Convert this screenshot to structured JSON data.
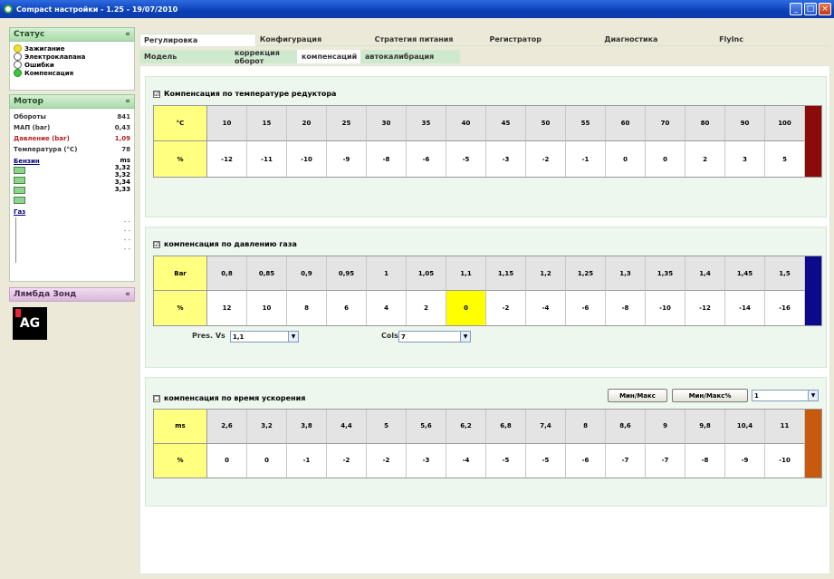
{
  "window": {
    "title": "Compact настройки - 1.25 - 19/07/2010"
  },
  "status": {
    "title": "Статус",
    "collapse": "«",
    "items": [
      {
        "label": "Зажигание",
        "state": "yellow"
      },
      {
        "label": "Электроклапана",
        "state": "off"
      },
      {
        "label": "Ошибки",
        "state": "off"
      },
      {
        "label": "Компенсация",
        "state": "green"
      }
    ]
  },
  "motor": {
    "title": "Мотор",
    "collapse": "«",
    "rows": [
      {
        "label": "Обороты",
        "value": "841"
      },
      {
        "label": "МАП (bar)",
        "value": "0,43"
      },
      {
        "label": "Давление (bar)",
        "value": "1,09"
      },
      {
        "label": "Температура (°C)",
        "value": "78"
      }
    ],
    "benzin_label": "Бензин",
    "benzin_unit": "ms",
    "benzin_values": [
      "3,32",
      "3,32",
      "3,34",
      "3,33"
    ],
    "gas_label": "Газ",
    "gas_values": [
      "- -",
      "- -",
      "- -",
      "- -"
    ]
  },
  "lambda": {
    "title": "Лямбда Зонд",
    "collapse": "«",
    "logo_text": "AG"
  },
  "tabs": [
    "Регулировка",
    "Конфигурация",
    "Стратегия питания",
    "Регистратор",
    "Диагностика",
    "FlyInc"
  ],
  "subtabs": [
    "Модель",
    "коррекция оборот",
    "компенсаций",
    "автокалибрация"
  ],
  "group1": {
    "title": "Компенсация по температуре редуктора",
    "checked": "☑",
    "header_unit": "°C",
    "value_unit": "%",
    "headers": [
      "10",
      "15",
      "20",
      "25",
      "30",
      "35",
      "40",
      "45",
      "50",
      "55",
      "60",
      "70",
      "80",
      "90",
      "100"
    ],
    "values": [
      "-12",
      "-11",
      "-10",
      "-9",
      "-8",
      "-6",
      "-5",
      "-3",
      "-2",
      "-1",
      "0",
      "0",
      "2",
      "3",
      "5"
    ],
    "bar_color": "#8B0A0A"
  },
  "group2": {
    "title": "компенсация по давлению газа",
    "checked": "☑",
    "header_unit": "Bar",
    "value_unit": "%",
    "headers": [
      "0,8",
      "0,85",
      "0,9",
      "0,95",
      "1",
      "1,05",
      "1,1",
      "1,15",
      "1,2",
      "1,25",
      "1,3",
      "1,35",
      "1,4",
      "1,45",
      "1,5"
    ],
    "values": [
      "12",
      "10",
      "8",
      "6",
      "4",
      "2",
      "0",
      "-2",
      "-4",
      "-6",
      "-8",
      "-10",
      "-12",
      "-14",
      "-16"
    ],
    "highlight_index": 6,
    "bar_color": "#0A0A8B",
    "pres_label": "Pres. Vs",
    "pres_value": "1,1",
    "cols_label": "Cols",
    "cols_value": "7"
  },
  "group3": {
    "title": "компенсация по время ускорения",
    "checked": "☐",
    "header_unit": "ms",
    "value_unit": "%",
    "headers": [
      "2,6",
      "3,2",
      "3,8",
      "4,4",
      "5",
      "5,6",
      "6,2",
      "6,8",
      "7,4",
      "8",
      "8,6",
      "9",
      "9,8",
      "10,4",
      "11"
    ],
    "values": [
      "0",
      "0",
      "-1",
      "-2",
      "-2",
      "-3",
      "-4",
      "-5",
      "-5",
      "-6",
      "-7",
      "-7",
      "-8",
      "-9",
      "-10"
    ],
    "bar_color": "#C85A10",
    "btn_minmax": "Мин/Макс",
    "btn_minmax_pct": "Мин/Макс%",
    "select_value": "1"
  }
}
